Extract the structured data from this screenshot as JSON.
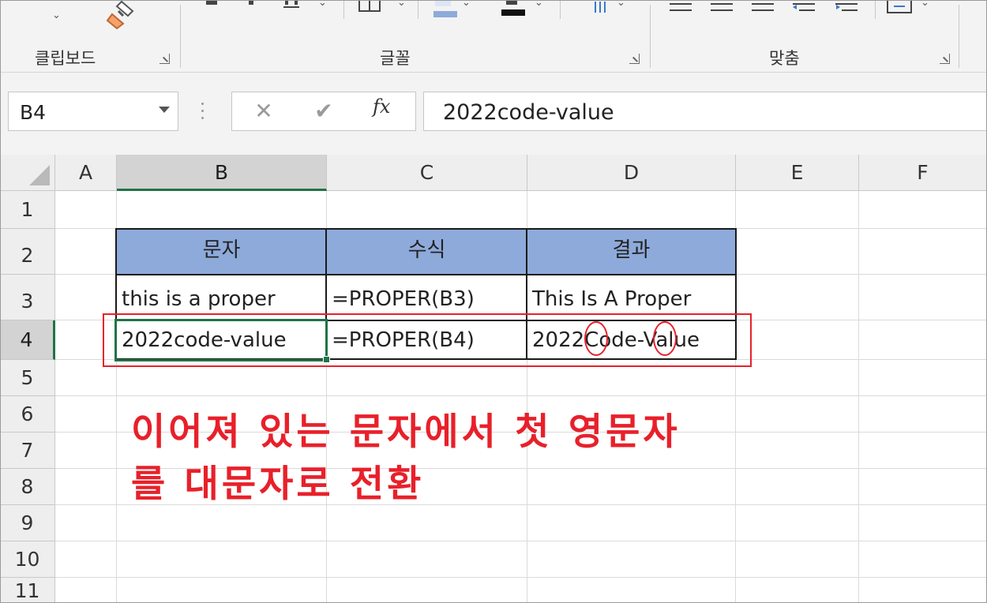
{
  "ribbon": {
    "groups": [
      {
        "label": "클립보드"
      },
      {
        "label": "글꼴"
      },
      {
        "label": "맞춤"
      }
    ]
  },
  "formula_bar": {
    "name_box": "B4",
    "cancel_icon": "✕",
    "enter_icon": "✔",
    "fx_label": "fx",
    "content": "2022code-value"
  },
  "sheet": {
    "columns": [
      "A",
      "B",
      "C",
      "D",
      "E",
      "F"
    ],
    "rows": [
      "1",
      "2",
      "3",
      "4",
      "5",
      "6",
      "7",
      "8",
      "9",
      "10",
      "11"
    ],
    "selected_cell": "B4",
    "table": {
      "headers": [
        "문자",
        "수식",
        "결과"
      ],
      "rows": [
        [
          "this is a proper",
          "=PROPER(B3)",
          "This Is A Proper"
        ],
        [
          "2022code-value",
          "=PROPER(B4)",
          "2022Code-Value"
        ]
      ]
    }
  },
  "annotation": {
    "line1": "이어져 있는 문자에서 첫 영문자",
    "line2": "를 대문자로 전환",
    "color": "#e8202a"
  },
  "colors": {
    "header_fill": "#8eaadb",
    "selection_green": "#217346",
    "highlight_red": "#e8202a"
  }
}
